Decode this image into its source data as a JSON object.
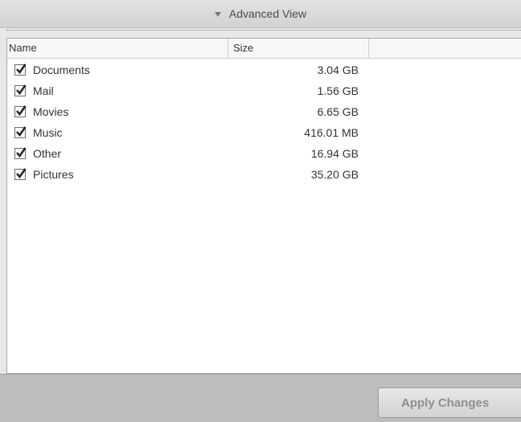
{
  "header": {
    "title": "Advanced View",
    "toggle_icon": "disclosure-triangle-down-icon"
  },
  "table": {
    "columns": {
      "name": "Name",
      "size": "Size"
    },
    "rows": [
      {
        "name": "Documents",
        "size": "3.04 GB",
        "checked": true
      },
      {
        "name": "Mail",
        "size": "1.56 GB",
        "checked": true
      },
      {
        "name": "Movies",
        "size": "6.65 GB",
        "checked": true
      },
      {
        "name": "Music",
        "size": "416.01 MB",
        "checked": true
      },
      {
        "name": "Other",
        "size": "16.94 GB",
        "checked": true
      },
      {
        "name": "Pictures",
        "size": "35.20 GB",
        "checked": true
      }
    ]
  },
  "footer": {
    "apply_label": "Apply Changes",
    "apply_enabled": false
  }
}
